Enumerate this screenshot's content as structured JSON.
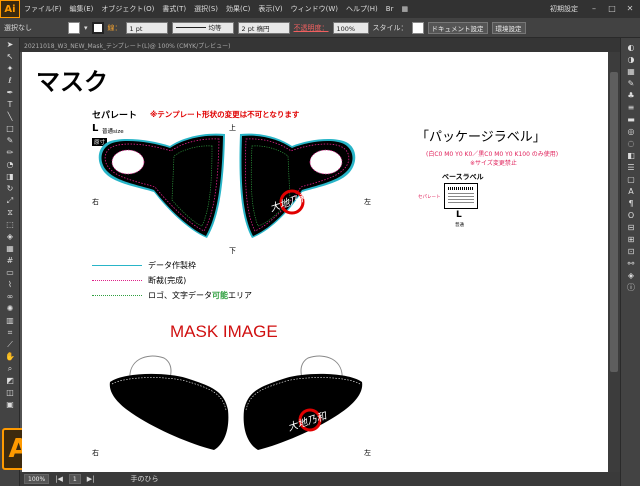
{
  "menubar": {
    "app_logo": "Ai",
    "items": [
      "ファイル(F)",
      "編集(E)",
      "オブジェクト(O)",
      "書式(T)",
      "選択(S)",
      "効果(C)",
      "表示(V)",
      "ウィンドウ(W)",
      "ヘルプ(H)"
    ],
    "workspace": "初期設定"
  },
  "controlbar": {
    "selection_label": "選択なし",
    "stroke_label": "線：",
    "stroke_value": "1 pt",
    "stroke_style": "均等",
    "brush_value": "2 pt 楕円",
    "opacity_label": "不透明度：",
    "opacity_value": "100%",
    "style_label": "スタイル：",
    "doc_setup_button": "ドキュメント設定",
    "prefs_button": "環境設定"
  },
  "tab": {
    "doc_title": "20211018_W3_NEW_Mask_テンプレート(L)@ 100% (CMYK/プレビュー)"
  },
  "statusbar": {
    "zoom": "100%",
    "page": "1",
    "tool": "手のひら"
  },
  "artboard": {
    "title": "マスク",
    "separate_label": "セパレート",
    "warning": "※テンプレート形状の変更は不可となります",
    "size_letter": "L",
    "size_text": "普通size",
    "tag_text": "原寸",
    "top_label": "上",
    "bottom_label": "下",
    "left_label": "左",
    "right_label": "右",
    "legend": [
      {
        "label": "データ作製枠",
        "color": "#29b5c8"
      },
      {
        "label": "断裁(完成)",
        "color": "#e0208a"
      },
      {
        "label": "ロゴ、文字データ",
        "highlight": "可能",
        "suffix": "エリア",
        "color": "#30a040"
      }
    ],
    "package_title": "「パッケージラベル」",
    "package_sub": "(白C0 M0 Y0 K0／黒C0 M0 Y0 K100 のみ使用)",
    "package_note": "※サイズ変更禁止",
    "base_label": "ベースラベル",
    "separate_small": "セパレート",
    "label_letter": "L",
    "label_size": "普通",
    "mask_image_title": "MASK IMAGE",
    "bottom_right_label": "右",
    "bottom_left_label": "左",
    "logo_text": "大地乃和"
  }
}
